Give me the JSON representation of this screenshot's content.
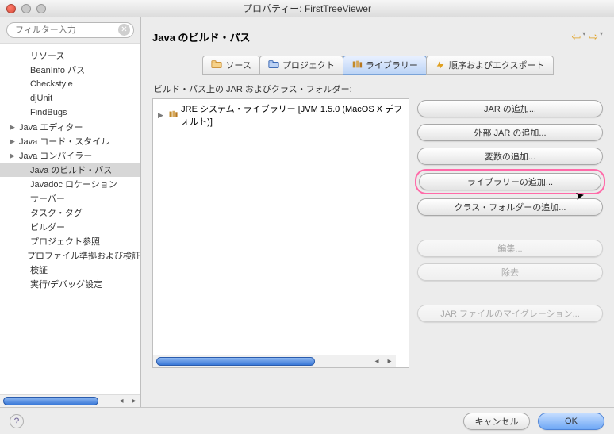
{
  "window": {
    "title": "プロパティー: FirstTreeViewer"
  },
  "filter": {
    "placeholder": "フィルター入力"
  },
  "sidebar": {
    "items": [
      {
        "label": "リソース",
        "expandable": false
      },
      {
        "label": "BeanInfo パス",
        "expandable": false
      },
      {
        "label": "Checkstyle",
        "expandable": false
      },
      {
        "label": "djUnit",
        "expandable": false
      },
      {
        "label": "FindBugs",
        "expandable": false
      },
      {
        "label": "Java エディター",
        "expandable": true
      },
      {
        "label": "Java コード・スタイル",
        "expandable": true
      },
      {
        "label": "Java コンパイラー",
        "expandable": true
      },
      {
        "label": "Java のビルド・パス",
        "expandable": false,
        "selected": true
      },
      {
        "label": "Javadoc ロケーション",
        "expandable": false
      },
      {
        "label": "サーバー",
        "expandable": false
      },
      {
        "label": "タスク・タグ",
        "expandable": false
      },
      {
        "label": "ビルダー",
        "expandable": false
      },
      {
        "label": "プロジェクト参照",
        "expandable": false
      },
      {
        "label": "プロファイル準拠および検証",
        "expandable": false
      },
      {
        "label": "検証",
        "expandable": false
      },
      {
        "label": "実行/デバッグ設定",
        "expandable": false
      }
    ]
  },
  "main": {
    "title": "Java のビルド・パス",
    "tabs": [
      {
        "label": "ソース"
      },
      {
        "label": "プロジェクト"
      },
      {
        "label": "ライブラリー",
        "active": true
      },
      {
        "label": "順序およびエクスポート"
      }
    ],
    "section_label": "ビルド・パス上の JAR およびクラス・フォルダー:",
    "list": {
      "items": [
        {
          "label": "JRE システム・ライブラリー [JVM 1.5.0 (MacOS X デフォルト)]"
        }
      ]
    },
    "buttons": {
      "add_jar": "JAR の追加...",
      "add_ext_jar": "外部 JAR の追加...",
      "add_var": "変数の追加...",
      "add_lib": "ライブラリーの追加...",
      "add_classfolder": "クラス・フォルダーの追加...",
      "edit": "編集...",
      "remove": "除去",
      "migrate": "JAR ファイルのマイグレーション..."
    }
  },
  "footer": {
    "cancel": "キャンセル",
    "ok": "OK"
  }
}
